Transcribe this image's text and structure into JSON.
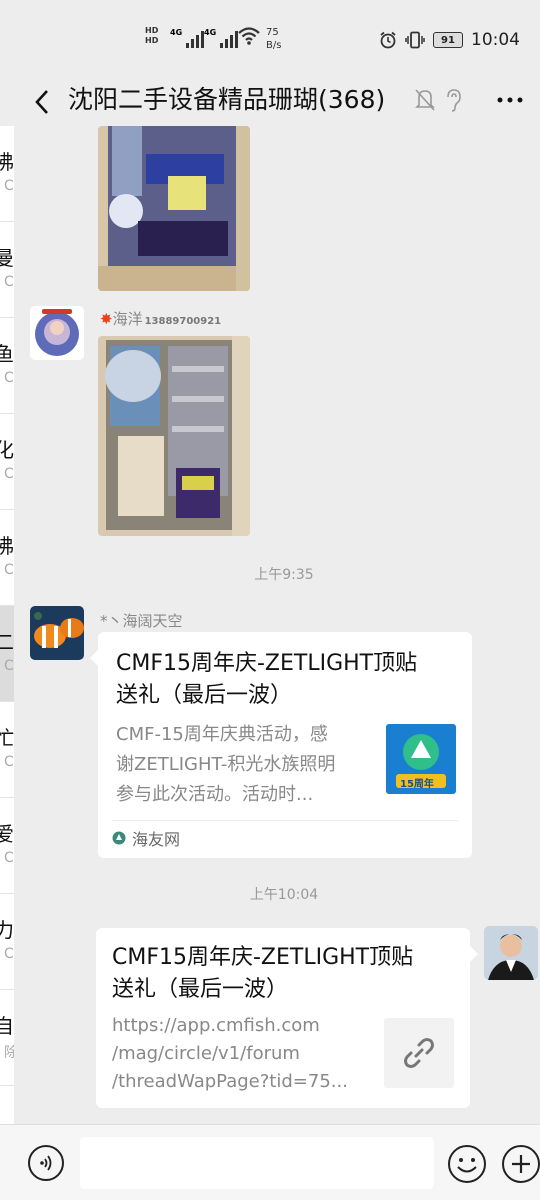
{
  "status_bar": {
    "network_1": "4G",
    "network_2": "4G",
    "hd_label": "HD",
    "speed_value": "75",
    "speed_unit": "B/s",
    "battery": "91",
    "time": "10:04"
  },
  "header": {
    "title": "沈阳二手设备精品珊瑚(368)"
  },
  "sidebar_items": [
    {
      "title": "沸",
      "sub": "C"
    },
    {
      "title": "曼",
      "sub": "C"
    },
    {
      "title": "鱼",
      "sub": "C"
    },
    {
      "title": "化",
      "sub": "C"
    },
    {
      "title": "沸",
      "sub": "C"
    },
    {
      "title": "二",
      "sub": "C"
    },
    {
      "title": "忙",
      "sub": "C"
    },
    {
      "title": "爱",
      "sub": "C"
    },
    {
      "title": "力",
      "sub": "C"
    },
    {
      "title": "自",
      "sub": "除"
    }
  ],
  "messages": {
    "sender_1": {
      "name": "海洋",
      "tel": "13889700921"
    },
    "time_1": "上午9:35",
    "sender_2": {
      "name": "*丶海阔天空"
    },
    "card_1": {
      "title_line1": "CMF15周年庆-ZETLIGHT顶贴",
      "title_line2": "送礼（最后一波）",
      "desc_line1": "CMF-15周年庆典活动，感",
      "desc_line2": "谢ZETLIGHT-积光水族照明",
      "desc_line3": "参与此次活动。活动时...",
      "thumb_text": "15周年",
      "source": "海友网"
    },
    "time_2": "上午10:04",
    "card_2": {
      "title_line1": "CMF15周年庆-ZETLIGHT顶贴",
      "title_line2": "送礼（最后一波）",
      "url_line1": "https://app.cmfish.com",
      "url_line2": "/mag/circle/v1/forum",
      "url_line3": "/threadWapPage?tid=75..."
    }
  },
  "input": {
    "placeholder": ""
  },
  "icons": {
    "back": "chevron-left-icon",
    "mute": "bell-muted-icon",
    "ear": "ear-icon",
    "more": "more-icon",
    "voice": "voice-icon",
    "emoji": "emoji-icon",
    "plus": "plus-icon",
    "link": "link-icon"
  },
  "colors": {
    "background": "#ededed",
    "card": "#ffffff",
    "text_primary": "#111111",
    "text_secondary": "#888888"
  }
}
